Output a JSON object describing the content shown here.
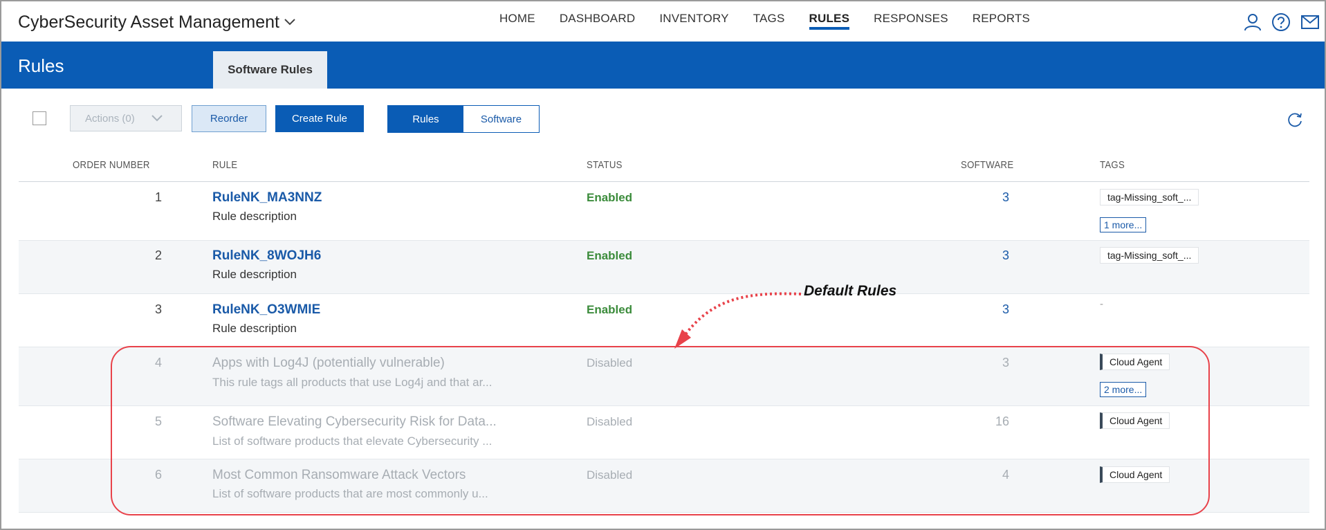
{
  "header": {
    "app_title": "CyberSecurity Asset Management",
    "nav": [
      {
        "label": "HOME",
        "active": false
      },
      {
        "label": "DASHBOARD",
        "active": false
      },
      {
        "label": "INVENTORY",
        "active": false
      },
      {
        "label": "TAGS",
        "active": false
      },
      {
        "label": "RULES",
        "active": true
      },
      {
        "label": "RESPONSES",
        "active": false
      },
      {
        "label": "REPORTS",
        "active": false
      }
    ],
    "icons": [
      "user-icon",
      "help-icon",
      "mail-icon"
    ]
  },
  "band": {
    "title": "Rules",
    "tab": "Software Rules"
  },
  "toolbar": {
    "actions_label": "Actions (0)",
    "reorder_label": "Reorder",
    "create_label": "Create Rule",
    "segments": [
      {
        "label": "Rules",
        "active": true
      },
      {
        "label": "Software",
        "active": false
      }
    ]
  },
  "table": {
    "columns": [
      "ORDER NUMBER",
      "RULE",
      "STATUS",
      "SOFTWARE",
      "TAGS"
    ],
    "rows": [
      {
        "order": "1",
        "name": "RuleNK_MA3NNZ",
        "description": "Rule description",
        "status": "Enabled",
        "software": "3",
        "tags": [
          "tag-Missing_soft_..."
        ],
        "more": "1 more..."
      },
      {
        "order": "2",
        "name": "RuleNK_8WOJH6",
        "description": "Rule description",
        "status": "Enabled",
        "software": "3",
        "tags": [
          "tag-Missing_soft_..."
        ],
        "more": ""
      },
      {
        "order": "3",
        "name": "RuleNK_O3WMIE",
        "description": "Rule description",
        "status": "Enabled",
        "software": "3",
        "tags": [],
        "empty_tags": "-",
        "more": ""
      },
      {
        "order": "4",
        "name": "Apps with Log4J (potentially vulnerable)",
        "description": "This rule tags all products that use Log4j and that ar...",
        "status": "Disabled",
        "software": "3",
        "tags": [
          "Cloud Agent"
        ],
        "more": "2 more..."
      },
      {
        "order": "5",
        "name": "Software Elevating Cybersecurity Risk for Data...",
        "description": "List of software products that elevate Cybersecurity ...",
        "status": "Disabled",
        "software": "16",
        "tags": [
          "Cloud Agent"
        ],
        "more": ""
      },
      {
        "order": "6",
        "name": "Most Common Ransomware Attack Vectors",
        "description": "List of software products that are most commonly u...",
        "status": "Disabled",
        "software": "4",
        "tags": [
          "Cloud Agent"
        ],
        "more": ""
      }
    ]
  },
  "annotation": {
    "label": "Default Rules",
    "color": "#e8424a"
  },
  "colors": {
    "brand_blue": "#0a5cb5",
    "enabled_green": "#3c8c3c",
    "disabled_gray": "#a7adb3"
  }
}
